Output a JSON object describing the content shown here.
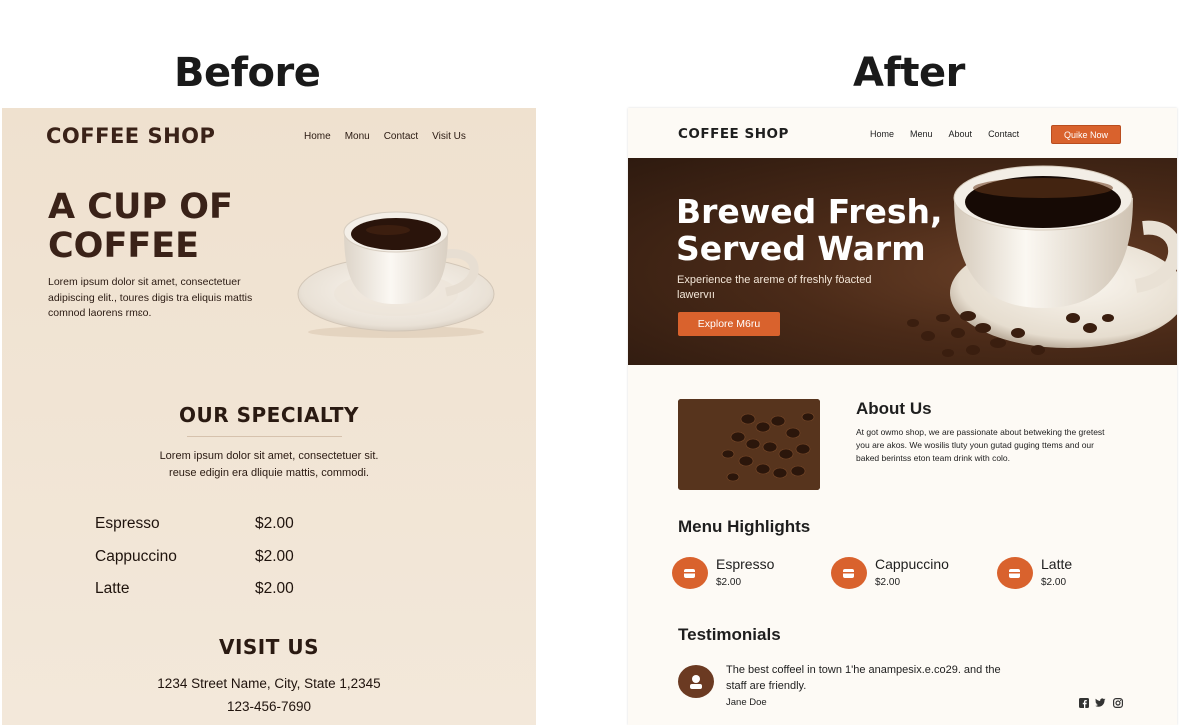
{
  "labels": {
    "before": "Before",
    "after": "After"
  },
  "before": {
    "logo": "COFFEE SHOP",
    "nav": [
      "Home",
      "Monu",
      "Contact",
      "Visit Us"
    ],
    "hero_title": "A CUP OF COFFEE",
    "hero_text": "Lorem ipsum dolor sit amet, consectetuer adipiscing elit., toures digis tra eliquis mattis comnod laorens rmɛo.",
    "specialty_title": "OUR SPECIALTY",
    "specialty_text_1": "Lorem ipsum dolor sit amet, consectetuer sit.",
    "specialty_text_2": "reuse edigin era dliquie mattis, commodi.",
    "menu": [
      {
        "name": "Espresso",
        "price": "$2.00"
      },
      {
        "name": "Cappuccino",
        "price": "$2.00"
      },
      {
        "name": "Latte",
        "price": "$2.00"
      }
    ],
    "visit_title": "VISIT US",
    "address": "1234 Street Name, City, State 1,2345",
    "phone": "123-456-7690"
  },
  "after": {
    "logo": "COFFEE SHOP",
    "nav": [
      "Home",
      "Menu",
      "About",
      "Contact"
    ],
    "cta_label": "Quike Now",
    "hero_title_1": "Brewed Fresh,",
    "hero_title_2": "Served Warm",
    "hero_text": "Experience the areme of freshly föacted lawervıı",
    "hero_button": "Explore M6ru",
    "about_title": "About Us",
    "about_text": "At got owmo shop, we are passionate about betweking the gretest you are akos. We wosilis tluty youn gutad guging ttems and our baked berintss eton team drink with colo.",
    "menu_title": "Menu Highlights",
    "menu": [
      {
        "name": "Espresso",
        "price": "$2.00"
      },
      {
        "name": "Cappuccino",
        "price": "$2.00"
      },
      {
        "name": "Latte",
        "price": "$2.00"
      }
    ],
    "testimonials_title": "Testimonials",
    "quote": "The best coffeel in town 1'he anampesix.e.co29. and the staff are friendly.",
    "author": "Jane Doe",
    "social_icons": [
      "facebook-icon",
      "twitter-icon",
      "instagram-icon"
    ],
    "accent_color": "#d9622d"
  }
}
